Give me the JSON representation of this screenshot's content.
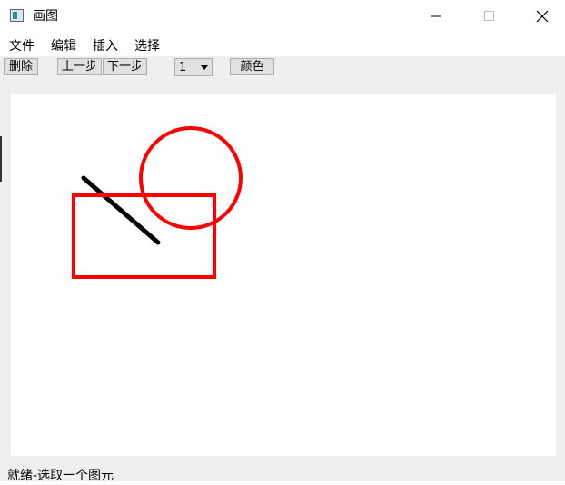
{
  "window": {
    "title": "画图"
  },
  "menu": {
    "items": [
      "文件",
      "编辑",
      "插入",
      "选择"
    ]
  },
  "toolbar": {
    "delete_label": "删除",
    "undo_label": "上一步",
    "redo_label": "下一步",
    "line_width_value": "1",
    "color_label": "颜色"
  },
  "canvas": {
    "shapes": [
      {
        "kind": "line",
        "color": "#000000"
      },
      {
        "kind": "circle",
        "color": "#ff0000"
      },
      {
        "kind": "rectangle",
        "color": "#ff0000"
      }
    ]
  },
  "status": {
    "text": "就绪-选取一个图元"
  },
  "icons": {
    "app": "paint-app-icon",
    "minimize": "minimize-icon",
    "maximize": "maximize-icon",
    "close": "close-icon",
    "dropdown": "chevron-down-icon"
  }
}
